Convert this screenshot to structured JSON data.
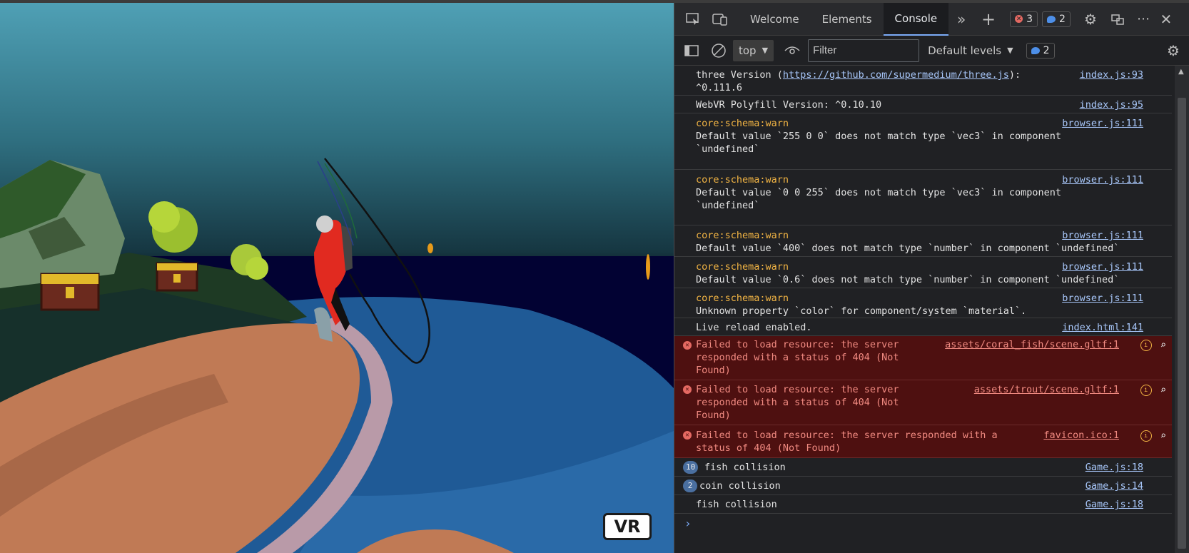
{
  "scene": {
    "vr_button_label": "VR",
    "colors": {
      "sky_top": "#4fa0b5",
      "sky_bottom": "#0e1a24",
      "ocean_dark": "#020233",
      "water": "#1f5a96",
      "sand": "#c07a55",
      "grass": "#1e3a24"
    }
  },
  "devtools": {
    "tabs": [
      {
        "label": "Welcome",
        "active": false
      },
      {
        "label": "Elements",
        "active": false
      },
      {
        "label": "Console",
        "active": true
      }
    ],
    "error_count": "3",
    "message_count": "2",
    "toolbar": {
      "context": "top",
      "filter_placeholder": "Filter",
      "levels": "Default levels",
      "badge_count": "2"
    },
    "console": {
      "rows": [
        {
          "type": "log",
          "text": "three Version (https://github.com/supermedium/three.js):\n^0.111.6",
          "source": "index.js:93"
        },
        {
          "type": "log",
          "text": "WebVR Polyfill Version: ^0.10.10",
          "source": "index.js:95"
        },
        {
          "type": "warn",
          "label": "core:schema:warn",
          "text": "Default value `255 0 0` does not match type `vec3` in component\n`undefined`",
          "source": "browser.js:111"
        },
        {
          "type": "warn",
          "label": "core:schema:warn",
          "text": "Default value `0 0 255` does not match type `vec3` in component\n`undefined`",
          "source": "browser.js:111"
        },
        {
          "type": "warn",
          "label": "core:schema:warn",
          "text": "Default value `400` does not match type `number` in component `undefined`",
          "source": "browser.js:111"
        },
        {
          "type": "warn",
          "label": "core:schema:warn",
          "text": "Default value `0.6` does not match type `number` in component `undefined`",
          "source": "browser.js:111"
        },
        {
          "type": "warn",
          "label": "core:schema:warn",
          "text": "Unknown property `color` for component/system `material`.",
          "source": "browser.js:111"
        },
        {
          "type": "log",
          "text": "Live reload enabled.",
          "source": "index.html:141"
        },
        {
          "type": "error",
          "text": "Failed to load resource: the server\nresponded with a status of 404 (Not\nFound)",
          "source": "assets/coral_fish/scene.gltf:1"
        },
        {
          "type": "error",
          "text": "Failed to load resource: the server\nresponded with a status of 404 (Not\nFound)",
          "source": "assets/trout/scene.gltf:1"
        },
        {
          "type": "error",
          "text": "Failed to load resource: the server responded with a\nstatus of 404 (Not Found)",
          "source": "favicon.ico:1"
        },
        {
          "type": "repeat",
          "count": "10",
          "text": "fish collision",
          "source": "Game.js:18"
        },
        {
          "type": "repeat",
          "count": "2",
          "text": "coin collision",
          "source": "Game.js:14"
        },
        {
          "type": "log",
          "text": "fish collision",
          "source": "Game.js:18"
        }
      ],
      "prompt": "›"
    }
  }
}
